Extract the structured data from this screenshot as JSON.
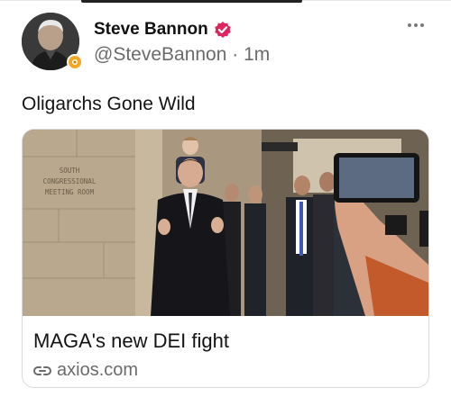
{
  "post": {
    "author_name": "Steve Bannon",
    "handle": "@SteveBannon",
    "separator": " · ",
    "time": "1m",
    "text": "Oligarchs Gone Wild"
  },
  "link_card": {
    "title": "MAGA's new DEI fight",
    "domain": "axios.com",
    "image_sign_text": [
      "SOUTH",
      "CONGRESSIONAL",
      "MEETING ROOM"
    ]
  },
  "icons": {
    "verified": "verified-check-icon",
    "more": "more-options-icon",
    "link": "link-icon",
    "badge": "affiliate-badge-icon"
  },
  "colors": {
    "verified": "#e0245e",
    "badge": "#f5a623",
    "secondary_text": "#6b6b6b"
  }
}
